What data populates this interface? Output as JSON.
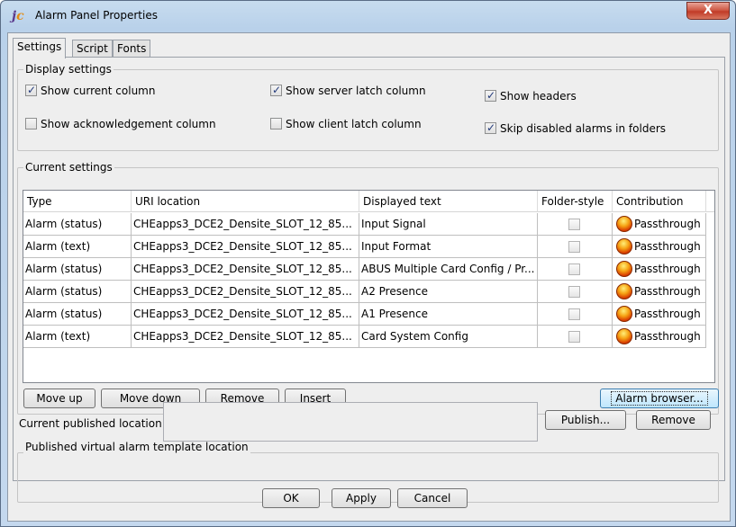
{
  "window": {
    "title": "Alarm Panel Properties",
    "close_glyph": "X",
    "app_icon": "jcs-app-icon"
  },
  "tabs": [
    "Settings",
    "Script",
    "Fonts"
  ],
  "display_settings": {
    "legend": "Display settings",
    "checkboxes": [
      {
        "label": "Show current column",
        "checked": true
      },
      {
        "label": "Show server latch column",
        "checked": true
      },
      {
        "label": "Show headers",
        "checked": true
      },
      {
        "label": "Show acknowledgement column",
        "checked": false
      },
      {
        "label": "Show client latch column",
        "checked": false
      },
      {
        "label": "Skip disabled alarms in folders",
        "checked": true
      }
    ]
  },
  "current_settings": {
    "legend": "Current settings",
    "columns": [
      "Type",
      "URI location",
      "Displayed text",
      "Folder-style",
      "Contribution"
    ],
    "rows": [
      {
        "type": "Alarm (status)",
        "uri": "CHEapps3_DCE2_Densite_SLOT_12_85...",
        "text": "Input Signal",
        "folder_style": false,
        "contribution": "Passthrough"
      },
      {
        "type": "Alarm (text)",
        "uri": "CHEapps3_DCE2_Densite_SLOT_12_85...",
        "text": "Input Format",
        "folder_style": false,
        "contribution": "Passthrough"
      },
      {
        "type": "Alarm (status)",
        "uri": "CHEapps3_DCE2_Densite_SLOT_12_85...",
        "text": "ABUS Multiple Card Config / Pr...",
        "folder_style": false,
        "contribution": "Passthrough"
      },
      {
        "type": "Alarm (status)",
        "uri": "CHEapps3_DCE2_Densite_SLOT_12_85...",
        "text": "A2 Presence",
        "folder_style": false,
        "contribution": "Passthrough"
      },
      {
        "type": "Alarm (status)",
        "uri": "CHEapps3_DCE2_Densite_SLOT_12_85...",
        "text": "A1 Presence",
        "folder_style": false,
        "contribution": "Passthrough"
      },
      {
        "type": "Alarm (text)",
        "uri": "CHEapps3_DCE2_Densite_SLOT_12_85...",
        "text": "Card System Config",
        "folder_style": false,
        "contribution": "Passthrough"
      }
    ],
    "buttons": {
      "move_up": "Move up",
      "move_down": "Move down",
      "remove": "Remove",
      "insert": "Insert",
      "alarm_browser": "Alarm browser..."
    }
  },
  "published": {
    "legend": "Published virtual alarm template location",
    "label": "Current published location:",
    "value": "",
    "publish": "Publish...",
    "remove": "Remove"
  },
  "footer": {
    "ok": "OK",
    "apply": "Apply",
    "cancel": "Cancel"
  }
}
